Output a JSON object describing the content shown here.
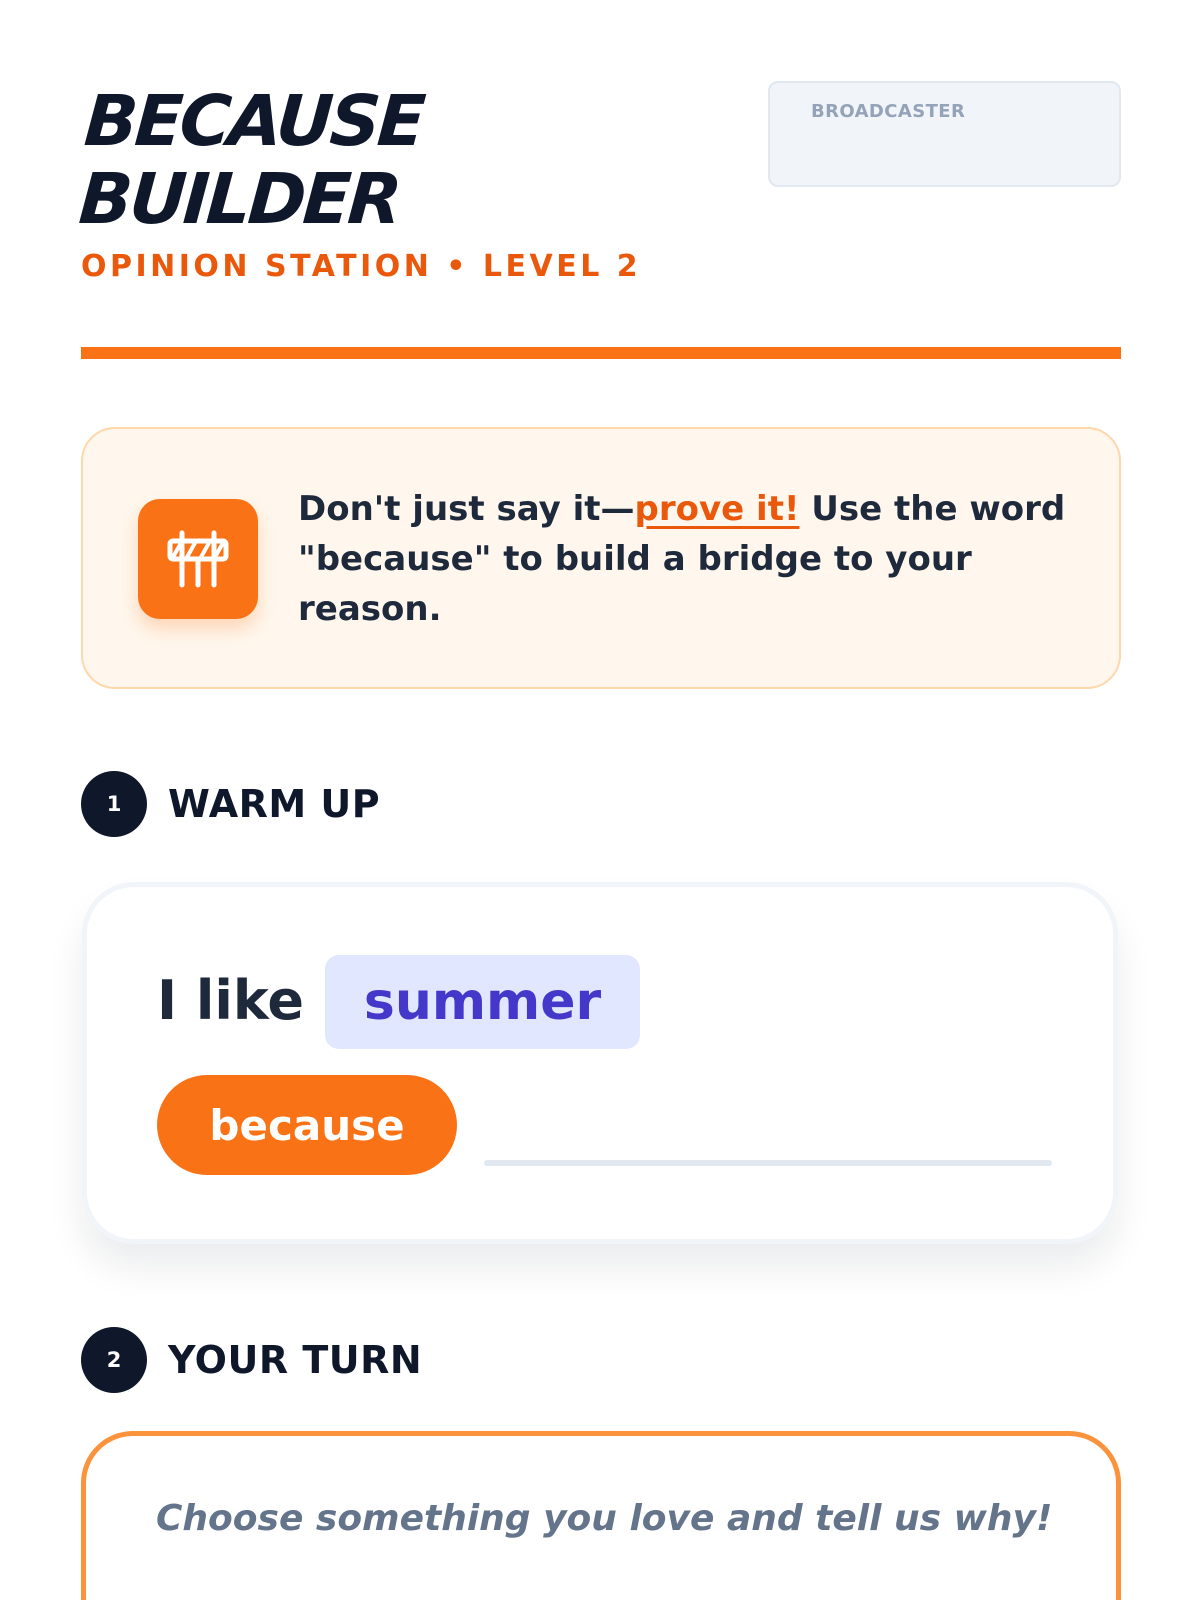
{
  "header": {
    "title_line1": "BECAUSE",
    "title_line2": "BUILDER",
    "subtitle": "OPINION STATION • LEVEL 2",
    "role_label": "BROADCASTER"
  },
  "tip": {
    "icon": "barrier-icon",
    "text_before": "Don't just say it—",
    "highlight": "prove it!",
    "text_after": " Use the word \"because\" to build a bridge to your reason."
  },
  "sections": [
    {
      "number": "1",
      "title": "WARM UP"
    },
    {
      "number": "2",
      "title": "YOUR TURN"
    }
  ],
  "warmup": {
    "lead": "I like",
    "choice": "summer",
    "connector": "because",
    "answer": ""
  },
  "your_turn": {
    "prompt": "Choose something you love and tell us why!"
  },
  "colors": {
    "accent": "#f97316",
    "accent_dark": "#ea580c",
    "ink": "#0f172a",
    "choice_bg": "#e0e7ff",
    "choice_text": "#4338ca"
  }
}
